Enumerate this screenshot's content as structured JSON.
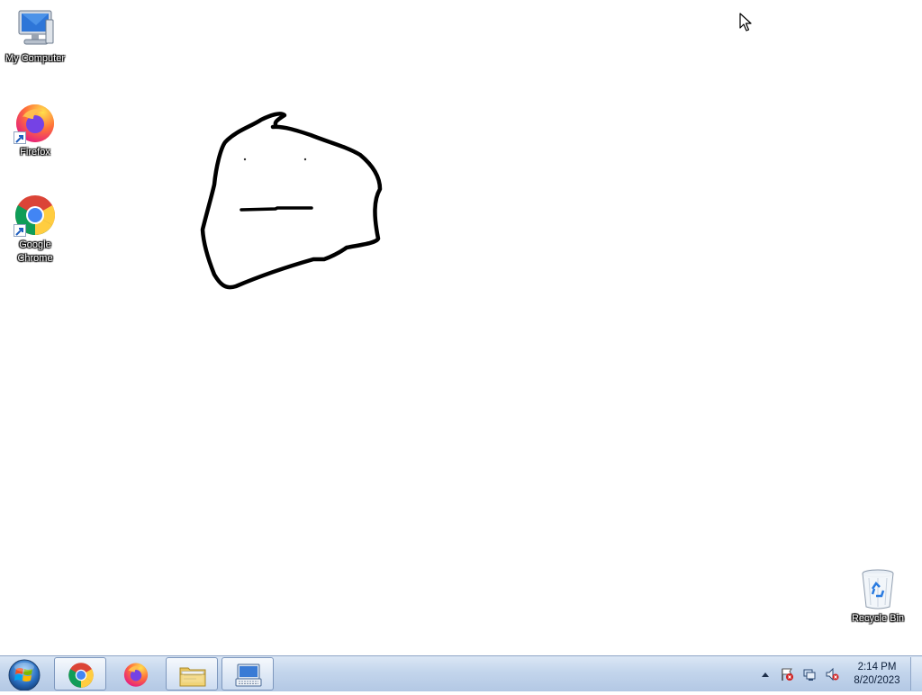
{
  "desktop": {
    "icons": [
      {
        "label": "My Computer",
        "icon": "computer-icon"
      },
      {
        "label": "Firefox",
        "icon": "firefox-icon"
      },
      {
        "label": "Google\nChrome",
        "icon": "chrome-icon"
      },
      {
        "label": "Recycle Bin",
        "icon": "recycle-bin-icon"
      }
    ],
    "drawing": "freehand-face-sketch"
  },
  "taskbar": {
    "buttons": [
      {
        "name": "start-button",
        "icon": "windows-orb-icon"
      },
      {
        "name": "chrome",
        "icon": "chrome-icon"
      },
      {
        "name": "firefox",
        "icon": "firefox-icon"
      },
      {
        "name": "file-explorer",
        "icon": "folder-icon"
      },
      {
        "name": "on-screen-keyboard",
        "icon": "keyboard-icon"
      }
    ],
    "tray": {
      "icons": [
        "show-hidden-icons-arrow",
        "action-center-flag-icon",
        "network-icon",
        "volume-muted-icon"
      ],
      "time": "2:14 PM",
      "date": "8/20/2023"
    }
  }
}
